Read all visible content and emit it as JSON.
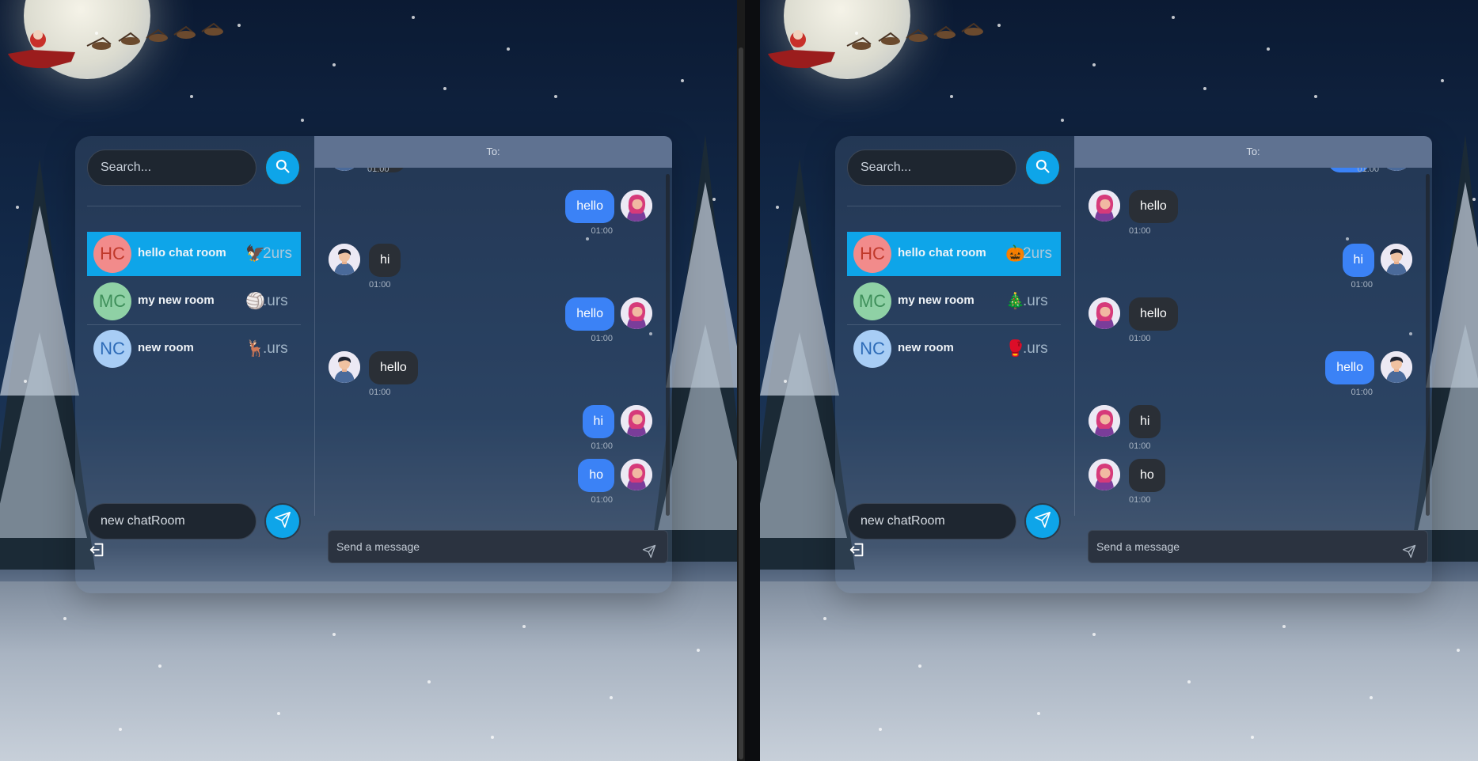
{
  "panes": [
    {
      "search": {
        "placeholder": "Search..."
      },
      "rooms": [
        {
          "initials": "HC",
          "name": "hello chat room",
          "emoji": "🦅",
          "count": "2urs",
          "active": true,
          "avatar_bg": "#f28b8b",
          "avatar_fg": "#c0392b"
        },
        {
          "initials": "MC",
          "name": "my new room",
          "emoji": "🏐",
          "count": ".urs",
          "active": false,
          "avatar_bg": "#8fd1a5",
          "avatar_fg": "#3e8f5a"
        },
        {
          "initials": "NC",
          "name": "new room",
          "emoji": "🦌",
          "count": ".urs",
          "active": false,
          "avatar_bg": "#a8cdf5",
          "avatar_fg": "#2e6cb8"
        }
      ],
      "new_room_value": "new chatRoom",
      "chat_header": "To:",
      "messages": [
        {
          "text": "hello",
          "time": "01:00",
          "me": true
        },
        {
          "text": "hi",
          "time": "01:00",
          "me": false
        },
        {
          "text": "hello",
          "time": "01:00",
          "me": true
        },
        {
          "text": "hello",
          "time": "01:00",
          "me": false
        },
        {
          "text": "hi",
          "time": "01:00",
          "me": true
        },
        {
          "text": "ho",
          "time": "01:00",
          "me": true
        }
      ],
      "top_time": "01:00",
      "composer_placeholder": "Send a message"
    },
    {
      "search": {
        "placeholder": "Search..."
      },
      "rooms": [
        {
          "initials": "HC",
          "name": "hello chat room",
          "emoji": "🎃",
          "count": "2urs",
          "active": true,
          "avatar_bg": "#f28b8b",
          "avatar_fg": "#c0392b"
        },
        {
          "initials": "MC",
          "name": "my new room",
          "emoji": "🎄",
          "count": ".urs",
          "active": false,
          "avatar_bg": "#8fd1a5",
          "avatar_fg": "#3e8f5a"
        },
        {
          "initials": "NC",
          "name": "new room",
          "emoji": "🥊",
          "count": ".urs",
          "active": false,
          "avatar_bg": "#a8cdf5",
          "avatar_fg": "#2e6cb8"
        }
      ],
      "new_room_value": "new chatRoom",
      "chat_header": "To:",
      "messages": [
        {
          "text": "hello",
          "time": "01:00",
          "me": false
        },
        {
          "text": "hi",
          "time": "01:00",
          "me": true
        },
        {
          "text": "hello",
          "time": "01:00",
          "me": false
        },
        {
          "text": "hello",
          "time": "01:00",
          "me": true
        },
        {
          "text": "hi",
          "time": "01:00",
          "me": false
        },
        {
          "text": "ho",
          "time": "01:00",
          "me": false
        }
      ],
      "top_time": "01:00",
      "composer_placeholder": "Send a message"
    }
  ],
  "colors": {
    "accent": "#0ea5e9",
    "bubble_me": "#3b82f6",
    "bubble_them": "#2a2f36",
    "header": "#5f7291"
  }
}
